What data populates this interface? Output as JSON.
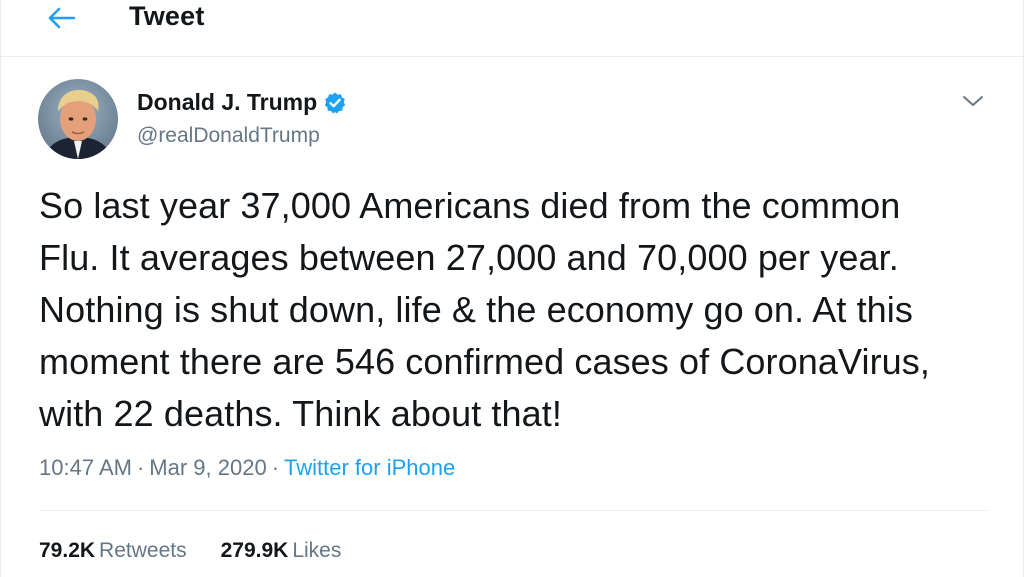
{
  "header": {
    "title": "Tweet",
    "back_icon": "arrow-left-icon"
  },
  "tweet": {
    "author": {
      "name": "Donald J. Trump",
      "handle": "@realDonaldTrump",
      "verified": true
    },
    "text": "So last year 37,000 Americans died from the common\nFlu. It averages between 27,000 and 70,000 per year.\nNothing is shut down, life & the economy go on. At this\nmoment there are 546 confirmed cases of CoronaVirus,\nwith 22 deaths. Think about that!",
    "time": "10:47 AM",
    "date": "Mar 9, 2020",
    "separator": "·",
    "source": "Twitter for iPhone",
    "retweets": {
      "count": "79.2K",
      "label": "Retweets"
    },
    "likes": {
      "count": "279.9K",
      "label": "Likes"
    }
  },
  "colors": {
    "accent": "#1da1f2",
    "text": "#14171a",
    "secondary": "#657786",
    "border": "#e6ecf0"
  }
}
